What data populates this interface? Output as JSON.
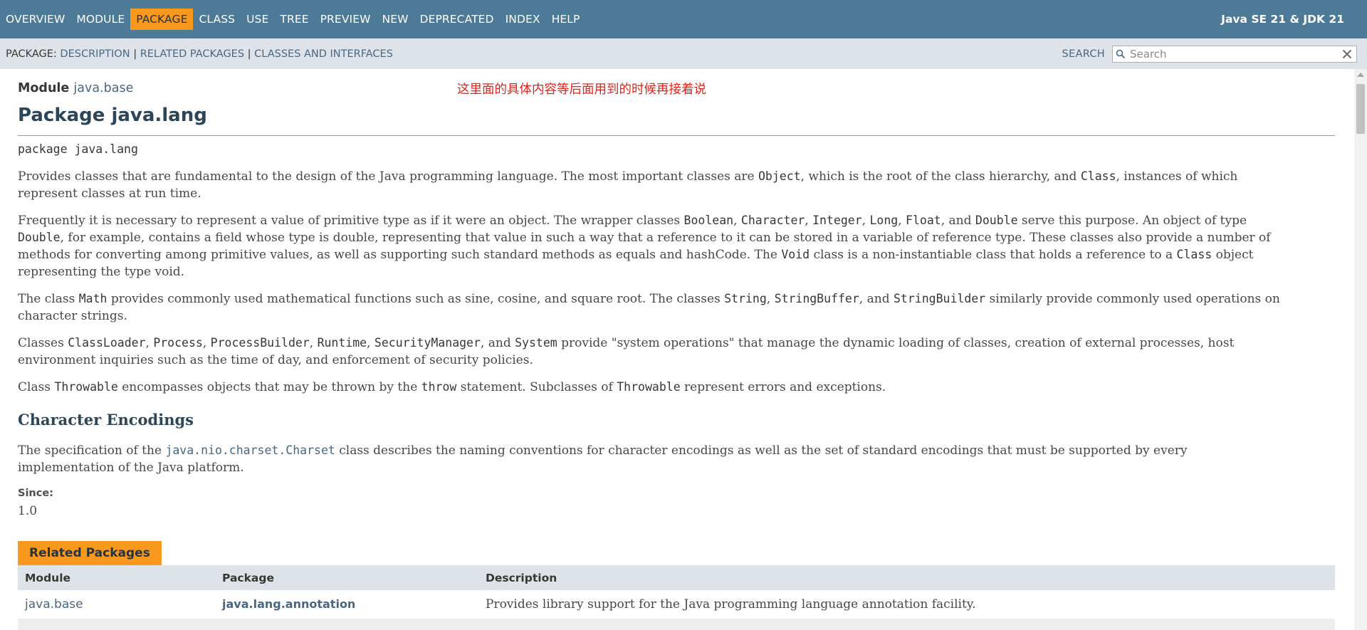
{
  "topnav": {
    "items": [
      "OVERVIEW",
      "MODULE",
      "PACKAGE",
      "CLASS",
      "USE",
      "TREE",
      "PREVIEW",
      "NEW",
      "DEPRECATED",
      "INDEX",
      "HELP"
    ],
    "active": "PACKAGE",
    "about": "Java SE 21 & JDK 21"
  },
  "subnav": {
    "prefix": "PACKAGE:",
    "links": [
      "DESCRIPTION",
      "RELATED PACKAGES",
      "CLASSES AND INTERFACES"
    ],
    "separator": "|",
    "search_label": "SEARCH",
    "search_placeholder": "Search"
  },
  "header": {
    "module_label": "Module",
    "module_link": "java.base",
    "title": "Package java.lang",
    "annotation": "这里面的具体内容等后面用到的时候再接着说"
  },
  "body": {
    "package_decl": "package java.lang",
    "p1": {
      "t1": "Provides classes that are fundamental to the design of the Java programming language. The most important classes are ",
      "c1": "Object",
      "t2": ", which is the root of the class hierarchy, and ",
      "c2": "Class",
      "t3": ", instances of which",
      "t4": "represent classes at run time."
    },
    "p2": {
      "t1": "Frequently it is necessary to represent a value of primitive type as if it were an object. The wrapper classes ",
      "c1": "Boolean",
      "s1": ", ",
      "c2": "Character",
      "s2": ", ",
      "c3": "Integer",
      "s3": ", ",
      "c4": "Long",
      "s4": ", ",
      "c5": "Float",
      "s5": ", and ",
      "c6": "Double",
      "t2": " serve this purpose. An object of type",
      "c7": "Double",
      "t3": ", for example, contains a field whose type is double, representing that value in such a way that a reference to it can be stored in a variable of reference type. These classes also provide a number of",
      "t4": "methods for converting among primitive values, as well as supporting such standard methods as equals and hashCode. The ",
      "c8": "Void",
      "t5": " class is a non-instantiable class that holds a reference to a ",
      "c9": "Class",
      "t6": " object",
      "t7": "representing the type void."
    },
    "p3": {
      "t1": "The class ",
      "c1": "Math",
      "t2": " provides commonly used mathematical functions such as sine, cosine, and square root. The classes ",
      "c2": "String",
      "s1": ", ",
      "c3": "StringBuffer",
      "s2": ", and ",
      "c4": "StringBuilder",
      "t3": " similarly provide commonly used operations on",
      "t4": "character strings."
    },
    "p4": {
      "t1": "Classes ",
      "c1": "ClassLoader",
      "s1": ", ",
      "c2": "Process",
      "s2": ", ",
      "c3": "ProcessBuilder",
      "s3": ", ",
      "c4": "Runtime",
      "s4": ", ",
      "c5": "SecurityManager",
      "s5": ", and ",
      "c6": "System",
      "t2": " provide \"system operations\" that manage the dynamic loading of classes, creation of external processes, host",
      "t3": "environment inquiries such as the time of day, and enforcement of security policies."
    },
    "p5": {
      "t1": "Class ",
      "c1": "Throwable",
      "t2": " encompasses objects that may be thrown by the ",
      "c2": "throw",
      "t3": " statement. Subclasses of ",
      "c3": "Throwable",
      "t4": " represent errors and exceptions."
    },
    "section_heading": "Character Encodings",
    "p6": {
      "t1": "The specification of the ",
      "link": "java.nio.charset.Charset",
      "t2": " class describes the naming conventions for character encodings as well as the set of standard encodings that must be supported by every",
      "t3": "implementation of the Java platform."
    },
    "since_label": "Since:",
    "since_value": "1.0"
  },
  "related_packages": {
    "caption": "Related Packages",
    "columns": [
      "Module",
      "Package",
      "Description"
    ],
    "rows": [
      {
        "module": "java.base",
        "package": "java.lang.annotation",
        "description": "Provides library support for the Java programming language annotation facility."
      }
    ]
  },
  "colors": {
    "nav_bg": "#4d7a97",
    "subnav_bg": "#dee3e9",
    "accent": "#f8981d",
    "link": "#4a6782",
    "annotation": "#e0241d"
  },
  "icons": {
    "search": "magnifier-icon",
    "reset": "close-icon"
  }
}
